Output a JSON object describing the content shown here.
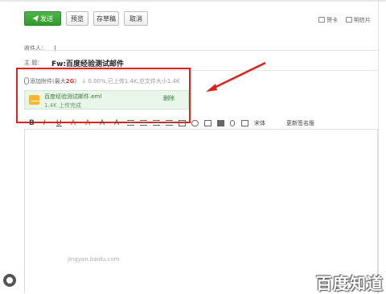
{
  "toolbar": {
    "send_label": "发送",
    "preview_label": "预览",
    "save_draft_label": "存草稿",
    "cancel_label": "取消",
    "secretary_label": "贺卡",
    "postcard_label": "明信片"
  },
  "form": {
    "recipient_label": "收件人：",
    "recipient_value": "|",
    "subject_label": "主  题：",
    "subject_value": "Fw:百度经验测试邮件"
  },
  "attachment": {
    "add_label": "添加附件",
    "limit_prefix": "(最大",
    "limit_value": "2G",
    "limit_suffix": ")",
    "progress_text": "↓ 0.00%,已上传1.4K,总文件大小1.4K",
    "file_name": "百度经验测试邮件.eml",
    "file_status": "1.4K  上传完成",
    "delete_label": "删除"
  },
  "format_bar": {
    "bold": "B",
    "italic": "I",
    "underline": "U",
    "font_color": "A",
    "bg_color": "A",
    "font_size": "A",
    "clear_format": "A",
    "font_family": "宋体",
    "signature_label": "更新签名版"
  },
  "watermark": {
    "bottom_text": "jingyan.baidu.com",
    "brand": "百度知道"
  },
  "colors": {
    "accent_green": "#3ba738",
    "highlight_red": "#e0221c",
    "attachment_bg": "#eaf6ea"
  }
}
